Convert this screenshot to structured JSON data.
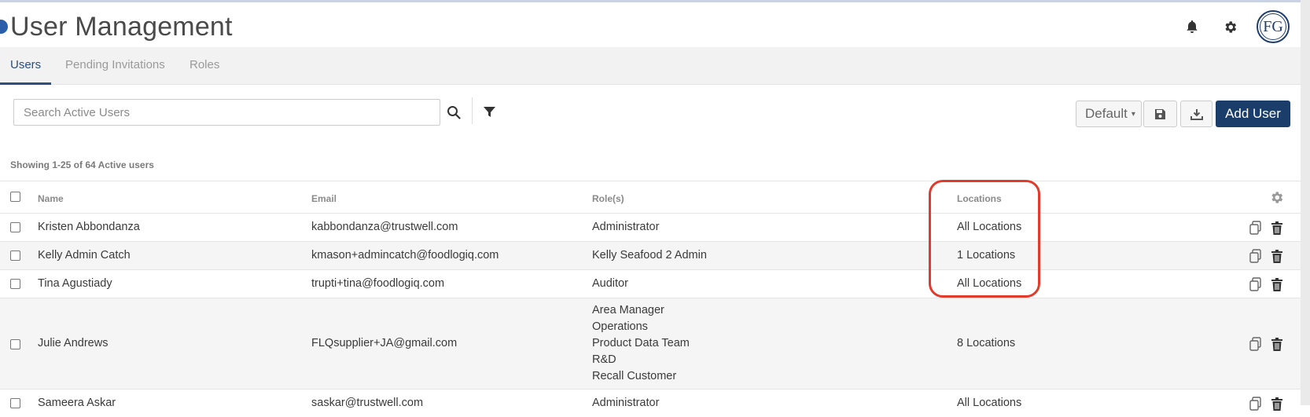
{
  "header": {
    "title": "User Management",
    "avatar_initials": "FG"
  },
  "tabs": [
    {
      "label": "Users",
      "active": true
    },
    {
      "label": "Pending Invitations",
      "active": false
    },
    {
      "label": "Roles",
      "active": false
    }
  ],
  "toolbar": {
    "search_placeholder": "Search Active Users",
    "view_select": "Default",
    "add_user_label": "Add User"
  },
  "summary": "Showing 1-25 of 64 Active users",
  "table": {
    "columns": [
      "Name",
      "Email",
      "Role(s)",
      "Locations"
    ],
    "rows": [
      {
        "name": "Kristen Abbondanza",
        "email": "kabbondanza@trustwell.com",
        "roles": [
          "Administrator"
        ],
        "locations": "All Locations"
      },
      {
        "name": "Kelly Admin Catch",
        "email": "kmason+admincatch@foodlogiq.com",
        "roles": [
          "Kelly Seafood 2 Admin"
        ],
        "locations": "1 Locations"
      },
      {
        "name": "Tina Agustiady",
        "email": "trupti+tina@foodlogiq.com",
        "roles": [
          "Auditor"
        ],
        "locations": "All Locations"
      },
      {
        "name": "Julie Andrews",
        "email": "FLQsupplier+JA@gmail.com",
        "roles": [
          "Area Manager",
          "Operations",
          "Product Data Team",
          "R&D",
          "Recall Customer"
        ],
        "locations": "8 Locations"
      },
      {
        "name": "Sameera Askar",
        "email": "saskar@trustwell.com",
        "roles": [
          "Administrator"
        ],
        "locations": "All Locations"
      }
    ]
  },
  "colors": {
    "primary": "#1b3d6a",
    "highlight": "#e03b2b",
    "tab_active": "#2b4f7e"
  }
}
